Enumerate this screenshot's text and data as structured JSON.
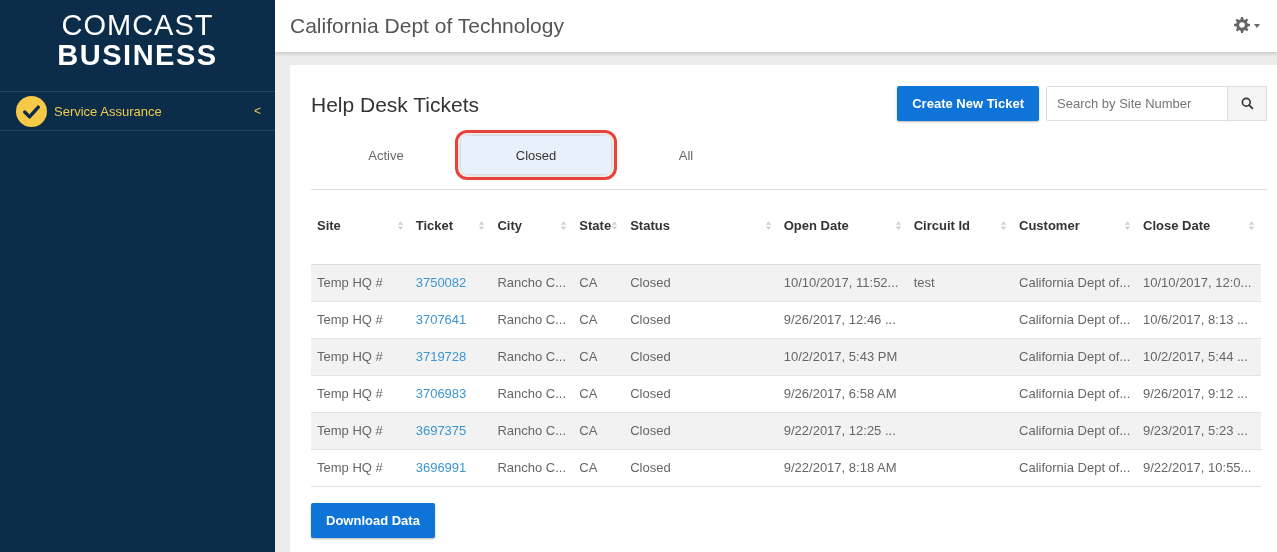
{
  "logo": {
    "line_1": "COMCAST",
    "line_2": "BUSINESS"
  },
  "sidebar": {
    "items": [
      {
        "label": "Service Assurance",
        "chevron": "<",
        "selected": true
      }
    ]
  },
  "header": {
    "title": "California Dept of Technology"
  },
  "panel": {
    "title": "Help Desk Tickets",
    "create_button": "Create New Ticket",
    "search": {
      "placeholder": "Search by Site Number"
    },
    "download_button": "Download Data"
  },
  "tabs": [
    {
      "label": "Active",
      "selected": false
    },
    {
      "label": "Closed",
      "selected": true
    },
    {
      "label": "All",
      "selected": false
    }
  ],
  "table": {
    "columns": [
      "Site",
      "Ticket",
      "City",
      "State",
      "Status",
      "Open Date",
      "Circuit Id",
      "Customer",
      "Close Date"
    ],
    "rows": [
      {
        "site": "Temp HQ #",
        "ticket": "3750082",
        "city": "Rancho C...",
        "state": "CA",
        "status": "Closed",
        "open_date": "10/10/2017, 11:52...",
        "circuit_id": "test",
        "customer": "California Dept of...",
        "close_date": "10/10/2017, 12:0..."
      },
      {
        "site": "Temp HQ #",
        "ticket": "3707641",
        "city": "Rancho C...",
        "state": "CA",
        "status": "Closed",
        "open_date": "9/26/2017, 12:46 ...",
        "customer": "California Dept of...",
        "close_date": "10/6/2017, 8:13 ..."
      },
      {
        "site": "Temp HQ #",
        "ticket": "3719728",
        "city": "Rancho C...",
        "state": "CA",
        "status": "Closed",
        "open_date": "10/2/2017, 5:43 PM",
        "customer": "California Dept of...",
        "close_date": "10/2/2017, 5:44 ..."
      },
      {
        "site": "Temp HQ #",
        "ticket": "3706983",
        "city": "Rancho C...",
        "state": "CA",
        "status": "Closed",
        "open_date": "9/26/2017, 6:58 AM",
        "customer": "California Dept of...",
        "close_date": "9/26/2017, 9:12 ..."
      },
      {
        "site": "Temp HQ #",
        "ticket": "3697375",
        "city": "Rancho C...",
        "state": "CA",
        "status": "Closed",
        "open_date": "9/22/2017, 12:25 ...",
        "customer": "California Dept of...",
        "close_date": "9/23/2017, 5:23 ..."
      },
      {
        "site": "Temp HQ #",
        "ticket": "3696991",
        "city": "Rancho C...",
        "state": "CA",
        "status": "Closed",
        "open_date": "9/22/2017, 8:18 AM",
        "customer": "California Dept of...",
        "close_date": "9/22/2017, 10:55..."
      }
    ]
  }
}
